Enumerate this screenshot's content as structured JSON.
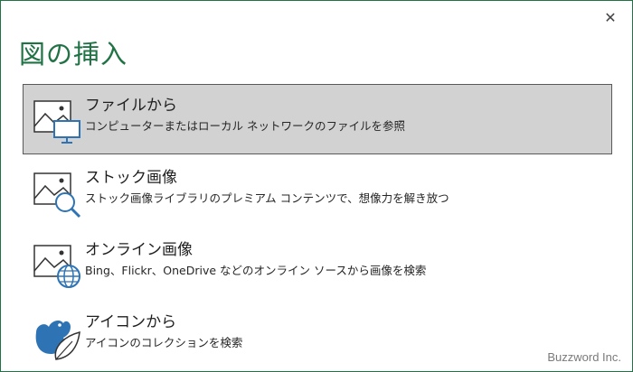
{
  "dialog": {
    "title": "図の挿入",
    "close_glyph": "✕"
  },
  "options": [
    {
      "title": "ファイルから",
      "description": "コンピューターまたはローカル ネットワークのファイルを参照",
      "icon": "picture-computer-icon",
      "selected": true
    },
    {
      "title": "ストック画像",
      "description": "ストック画像ライブラリのプレミアム コンテンツで、想像力を解き放つ",
      "icon": "picture-search-icon",
      "selected": false
    },
    {
      "title": "オンライン画像",
      "description": "Bing、Flickr、OneDrive などのオンライン ソースから画像を検索",
      "icon": "picture-globe-icon",
      "selected": false
    },
    {
      "title": "アイコンから",
      "description": "アイコンのコレクションを検索",
      "icon": "bird-leaf-icon",
      "selected": false
    }
  ],
  "watermark": "Buzzword Inc.",
  "colors": {
    "accent": "#217346",
    "selected_bg": "#d2d2d2",
    "icon_blue": "#2e74b5"
  }
}
